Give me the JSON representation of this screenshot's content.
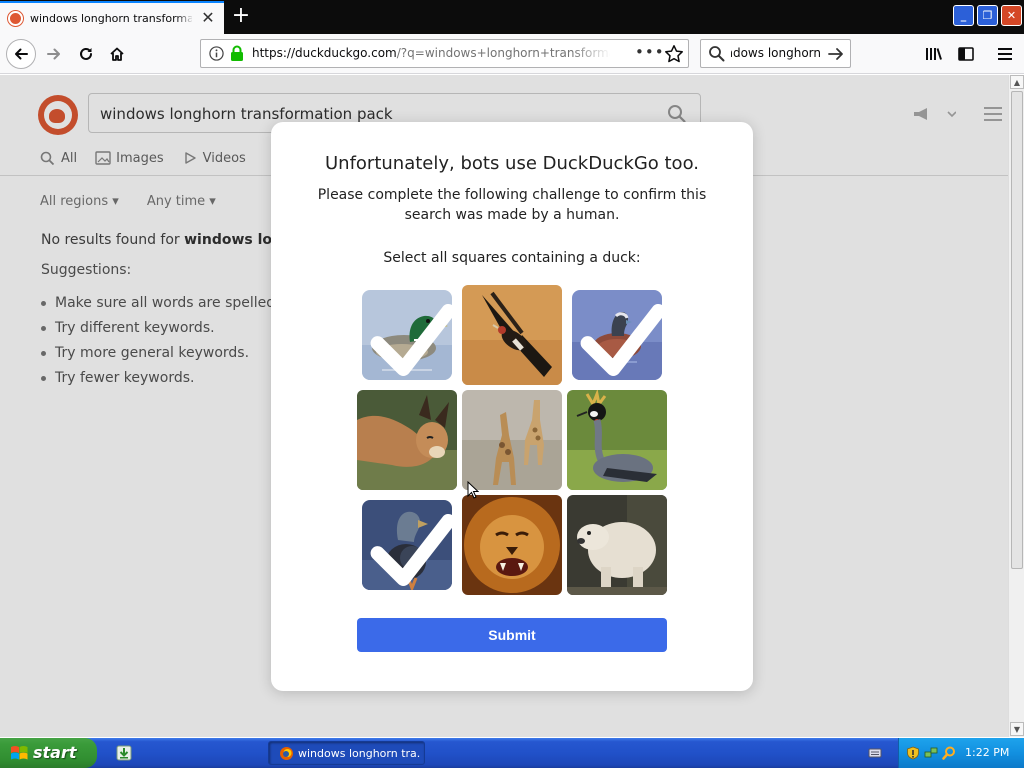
{
  "browser": {
    "tab": {
      "title": "windows longhorn transformation pack"
    },
    "urlbar": {
      "url_host": "https://duckduckgo.com",
      "url_path": "/?q=windows+longhorn+transformation+pack"
    },
    "searchbar": {
      "value": "windows longhorn"
    }
  },
  "page": {
    "search_value": "windows longhorn transformation pack",
    "tabs": [
      "All",
      "Images",
      "Videos"
    ],
    "filters": [
      "All regions",
      "Any time"
    ],
    "no_results_prefix": "No results found for ",
    "no_results_query": "windows longhorn transformation pack",
    "suggestions_heading": "Suggestions:",
    "suggestions": [
      "Make sure all words are spelled correctly.",
      "Try different keywords.",
      "Try more general keywords.",
      "Try fewer keywords."
    ]
  },
  "captcha": {
    "title": "Unfortunately, bots use DuckDuckGo too.",
    "subtitle": "Please complete the following challenge to confirm this search was made by a human.",
    "instruction": "Select all squares containing a duck:",
    "tiles": [
      {
        "subject": "mallard duck",
        "selected": true
      },
      {
        "subject": "bird in flight",
        "selected": false
      },
      {
        "subject": "duck on water",
        "selected": true
      },
      {
        "subject": "caracal",
        "selected": false
      },
      {
        "subject": "giraffes",
        "selected": false
      },
      {
        "subject": "crowned crane",
        "selected": false
      },
      {
        "subject": "duck",
        "selected": true
      },
      {
        "subject": "lion",
        "selected": false
      },
      {
        "subject": "polar bear",
        "selected": false
      }
    ],
    "submit_label": "Submit"
  },
  "taskbar": {
    "start_label": "start",
    "task_label": "windows longhorn tra...",
    "clock": "1:22 PM"
  },
  "colors": {
    "ddg_orange": "#de5833",
    "submit_blue": "#3b6ae9",
    "xp_blue": "#2151c9",
    "xp_green": "#3a9b3a"
  }
}
